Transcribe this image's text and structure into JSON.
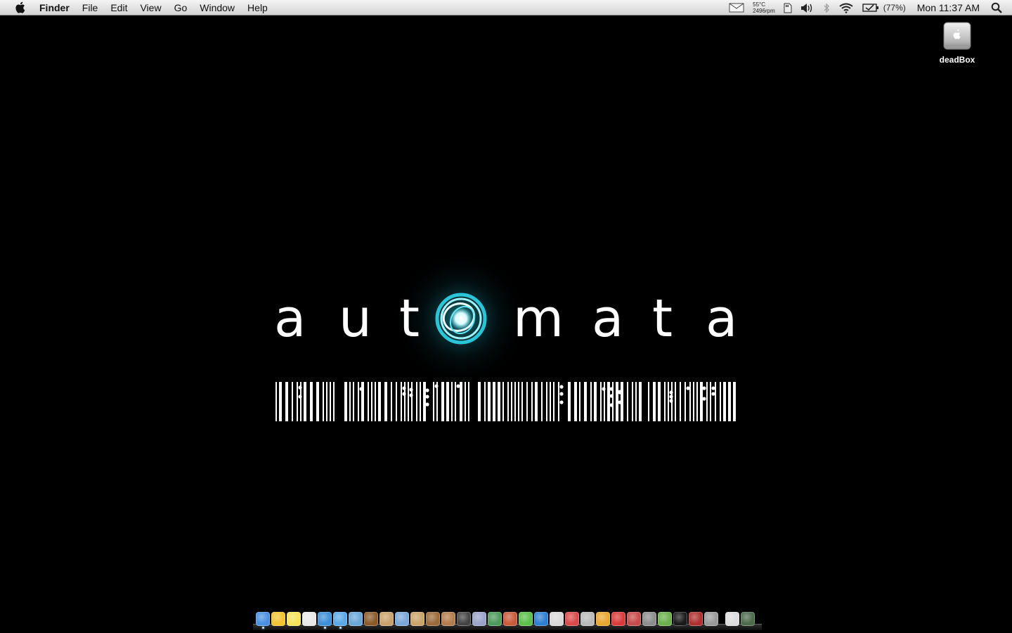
{
  "menubar": {
    "app_name": "Finder",
    "menus": [
      "File",
      "Edit",
      "View",
      "Go",
      "Window",
      "Help"
    ],
    "status": {
      "temperature": "55°C",
      "fan_speed": "2496rpm",
      "battery_percent": "(77%)",
      "clock": "Mon 11:37 AM"
    }
  },
  "desktop": {
    "icons": [
      {
        "label": "deadBox"
      }
    ],
    "wallpaper": {
      "wordmark": [
        "a",
        "u",
        "t",
        "m",
        "a",
        "t",
        "a"
      ],
      "accent": "#2fd6ea"
    }
  },
  "dock": {
    "apps": [
      {
        "icon": "finder-icon",
        "color": "#4a90e2",
        "running": true
      },
      {
        "icon": "adium-icon",
        "color": "#f2c230",
        "running": false
      },
      {
        "icon": "stickies-icon",
        "color": "#f5e45a",
        "running": false
      },
      {
        "icon": "ical-icon",
        "color": "#e8e8e8",
        "running": false
      },
      {
        "icon": "safari-icon",
        "color": "#3d8fd8",
        "running": true
      },
      {
        "icon": "ichat-icon",
        "color": "#5aa9e6",
        "running": true
      },
      {
        "icon": "itunes-icon",
        "color": "#6aa8d8",
        "running": false
      },
      {
        "icon": "utility-icon",
        "color": "#8b5a2b",
        "running": false
      },
      {
        "icon": "basket-icon",
        "color": "#c9a26b",
        "running": false
      },
      {
        "icon": "preview-icon",
        "color": "#7aa7d6",
        "running": false
      },
      {
        "icon": "folder-icon",
        "color": "#caa36a",
        "running": false
      },
      {
        "icon": "acorn-icon",
        "color": "#9a6a3a",
        "running": false
      },
      {
        "icon": "photo-icon",
        "color": "#b37c4c",
        "running": false
      },
      {
        "icon": "imovie-icon",
        "color": "#444444",
        "running": false
      },
      {
        "icon": "pen-icon",
        "color": "#9aa3c8",
        "running": false
      },
      {
        "icon": "chart-icon",
        "color": "#4d9a5a",
        "running": false
      },
      {
        "icon": "paint-icon",
        "color": "#c85a3a",
        "running": false
      },
      {
        "icon": "h-icon",
        "color": "#5bbf4a",
        "running": false
      },
      {
        "icon": "quicktime-icon",
        "color": "#2f7fd0",
        "running": false
      },
      {
        "icon": "remote-icon",
        "color": "#d9d9d9",
        "running": false
      },
      {
        "icon": "skitch-icon",
        "color": "#d94a4a",
        "running": false
      },
      {
        "icon": "photobooth-icon",
        "color": "#b9b9b9",
        "running": false
      },
      {
        "icon": "glasses-icon",
        "color": "#e8a630",
        "running": false
      },
      {
        "icon": "poker-icon",
        "color": "#d93a3a",
        "running": false
      },
      {
        "icon": "tool-icon",
        "color": "#c84a4a",
        "running": false
      },
      {
        "icon": "scanner-icon",
        "color": "#8c8c8c",
        "running": false
      },
      {
        "icon": "automator-icon",
        "color": "#6ab04c",
        "running": false
      },
      {
        "icon": "terminal-icon",
        "color": "#1a1a1a",
        "running": false
      },
      {
        "icon": "record-icon",
        "color": "#b03030",
        "running": false
      },
      {
        "icon": "system-prefs-icon",
        "color": "#9a9a9a",
        "running": false
      },
      {
        "icon": "downloads-icon",
        "color": "#dddddd",
        "running": false
      },
      {
        "icon": "trash-icon",
        "color": "#4c6a4c",
        "running": false
      }
    ]
  }
}
